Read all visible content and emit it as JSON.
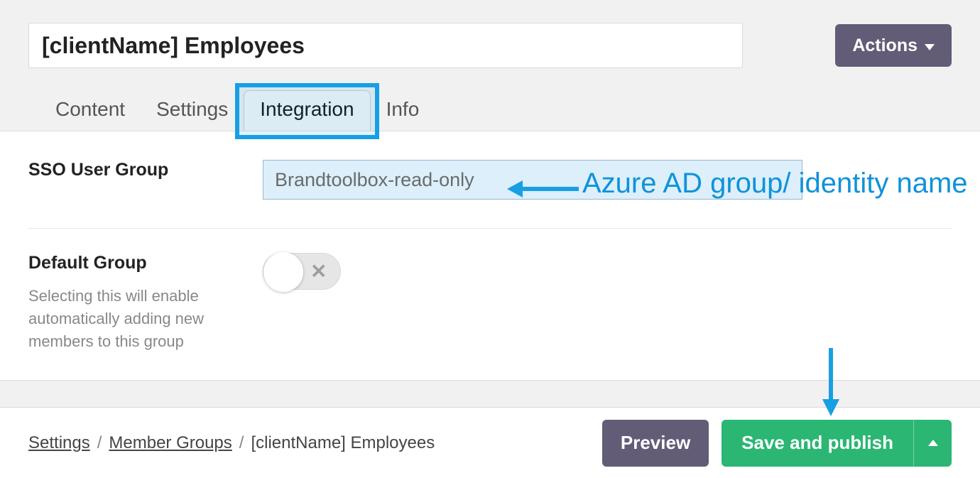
{
  "header": {
    "title": "[clientName] Employees",
    "actions_label": "Actions"
  },
  "tabs": [
    {
      "label": "Content"
    },
    {
      "label": "Settings"
    },
    {
      "label": "Integration"
    },
    {
      "label": "Info"
    }
  ],
  "fields": {
    "sso": {
      "label": "SSO User Group",
      "value": "Brandtoolbox-read-only"
    },
    "default_group": {
      "label": "Default Group",
      "help": "Selecting this will enable automatically adding new members to this group"
    }
  },
  "breadcrumb": {
    "settings": "Settings",
    "member_groups": "Member Groups",
    "current": "[clientName] Employees"
  },
  "footer": {
    "preview_label": "Preview",
    "save_label": "Save and publish"
  },
  "annotations": {
    "sso_hint": "Azure AD group/ identity name"
  },
  "colors": {
    "highlight": "#189fe3",
    "primary_button": "#635c76",
    "success_button": "#2bb673"
  }
}
